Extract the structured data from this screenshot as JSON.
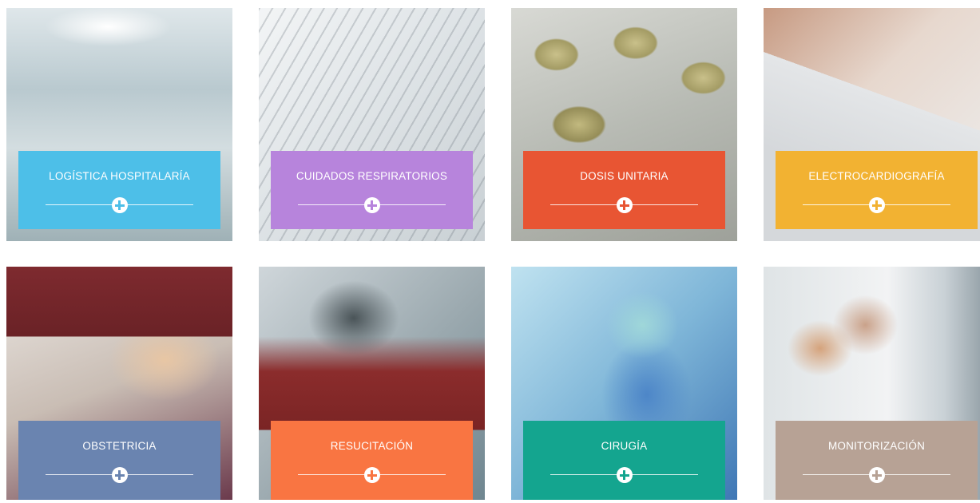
{
  "tiles": [
    {
      "label": "LOGÍSTICA HOSPITALARÍA",
      "color": "#4dbfe8",
      "photo": "hospital-corridor-photo"
    },
    {
      "label": "CUIDADOS RESPIRATORIOS",
      "color": "#b784dc",
      "photo": "syringe-photo"
    },
    {
      "label": "DOSIS UNITARIA",
      "color": "#e85533",
      "photo": "pills-photo"
    },
    {
      "label": "ELECTROCARDIOGRAFÍA",
      "color": "#f2b232",
      "photo": "ecg-machine-photo"
    },
    {
      "label": "OBSTETRICIA",
      "color": "#6a84b0",
      "photo": "pregnant-patient-photo"
    },
    {
      "label": "RESUCITACIÓN",
      "color": "#f97542",
      "photo": "defibrillator-photo"
    },
    {
      "label": "CIRUGÍA",
      "color": "#14a58f",
      "photo": "surgeon-photo"
    },
    {
      "label": "MONITORIZACIÓN",
      "color": "#b7a295",
      "photo": "doctors-monitor-photo"
    }
  ],
  "icons": {
    "expand": "plus-circle-icon"
  }
}
